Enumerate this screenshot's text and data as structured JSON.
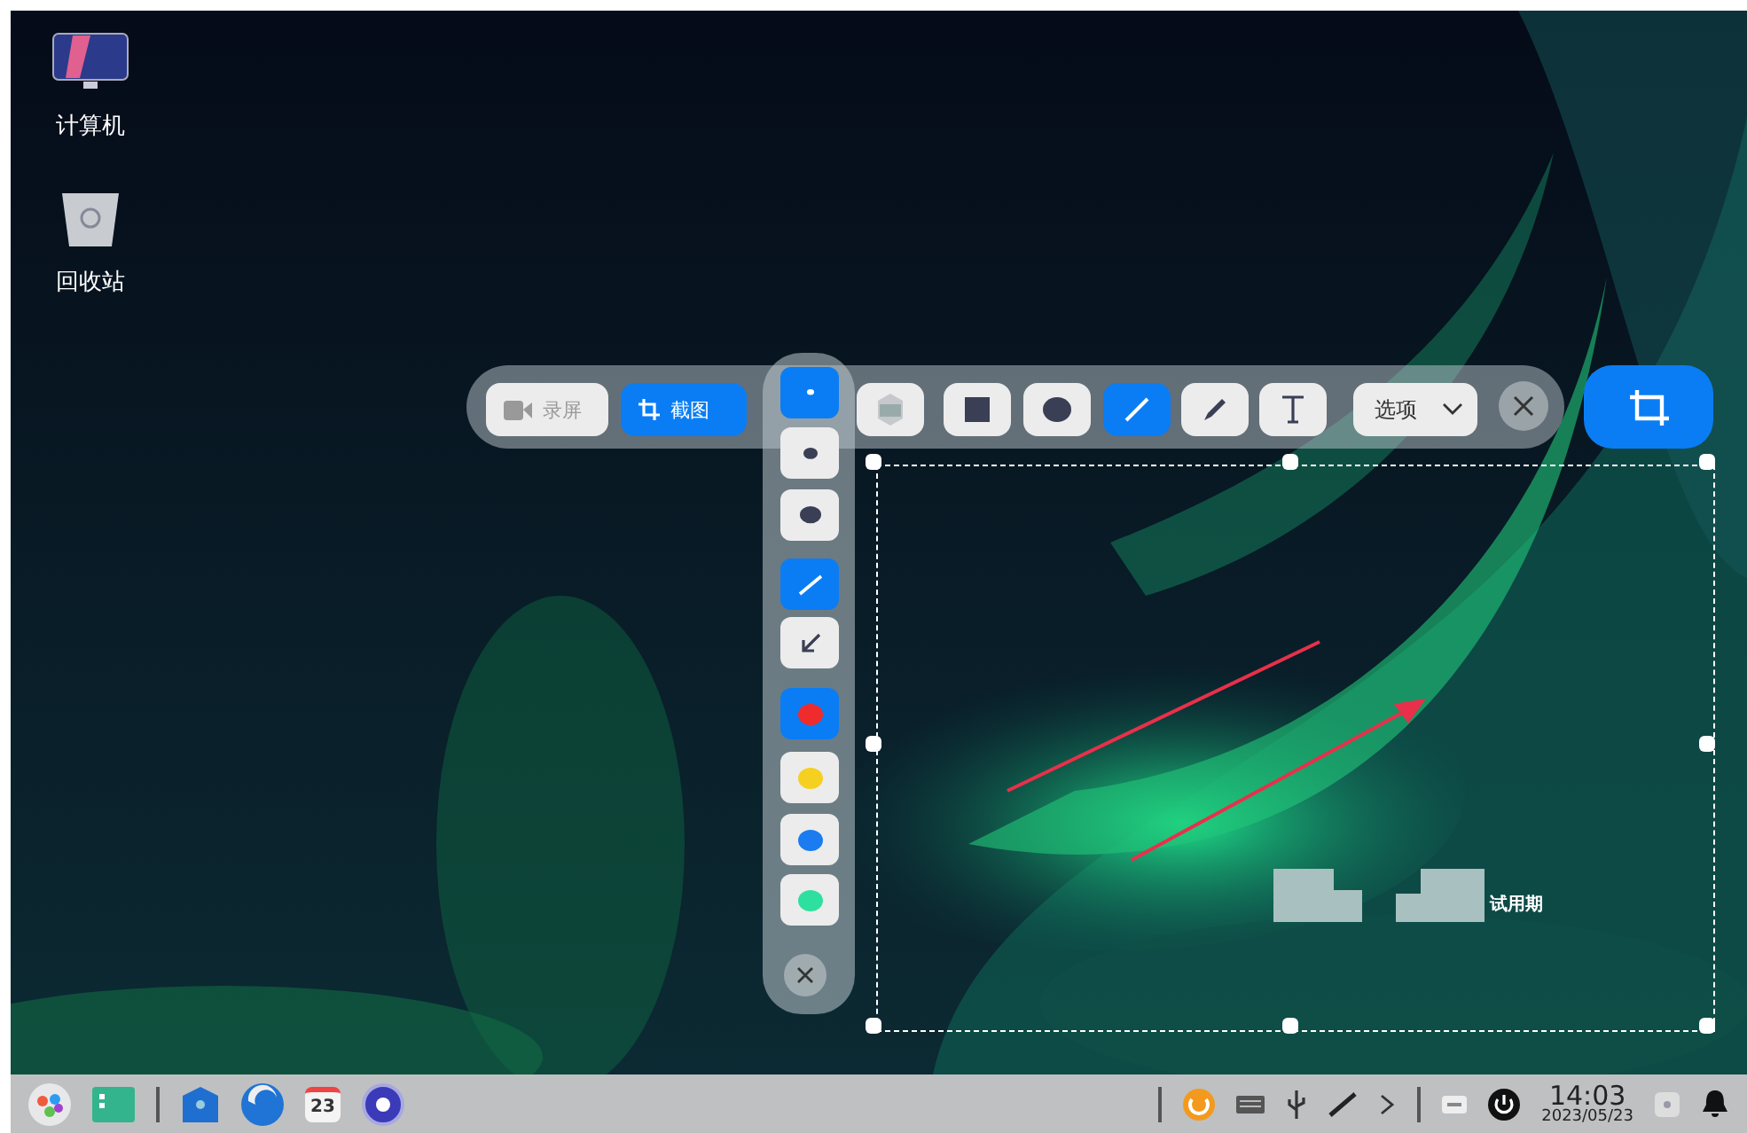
{
  "desktop_icons": [
    {
      "kind": "computer",
      "label": "计算机"
    },
    {
      "kind": "trash",
      "label": "回收站"
    }
  ],
  "mode_buttons": [
    {
      "kind": "record",
      "label": "录屏",
      "selected": false
    },
    {
      "kind": "screenshot",
      "label": "截图",
      "selected": true
    }
  ],
  "tools": [
    {
      "kind": "blur",
      "selected": false
    },
    {
      "kind": "rect",
      "selected": false
    },
    {
      "kind": "ellipse",
      "selected": false
    },
    {
      "kind": "line",
      "selected": true
    },
    {
      "kind": "pen",
      "selected": false
    },
    {
      "kind": "text",
      "selected": false
    }
  ],
  "options": {
    "label": "选项"
  },
  "pen_sizes": [
    {
      "kind": "small",
      "selected": true
    },
    {
      "kind": "medium",
      "selected": false
    },
    {
      "kind": "large",
      "selected": false
    }
  ],
  "line_styles": [
    {
      "kind": "line",
      "selected": true
    },
    {
      "kind": "arrow",
      "selected": false
    }
  ],
  "colors": [
    {
      "color": "#f02b2b",
      "selected": true
    },
    {
      "color": "#f5d020",
      "selected": false
    },
    {
      "color": "#1a7cf0",
      "selected": false
    },
    {
      "color": "#2ee0a0",
      "selected": false
    }
  ],
  "selection": {
    "window_label": "试用期"
  },
  "taskbar": {
    "apps": [
      {
        "kind": "launcher"
      },
      {
        "kind": "files"
      },
      {
        "kind": "store"
      },
      {
        "kind": "browser"
      },
      {
        "kind": "calendar",
        "day": "23"
      },
      {
        "kind": "settings"
      }
    ],
    "tray": [
      {
        "kind": "power-manager"
      },
      {
        "kind": "keyboard"
      },
      {
        "kind": "usb"
      },
      {
        "kind": "pen"
      },
      {
        "kind": "expand"
      }
    ],
    "time": "14:03",
    "date": "2023/05/23"
  }
}
